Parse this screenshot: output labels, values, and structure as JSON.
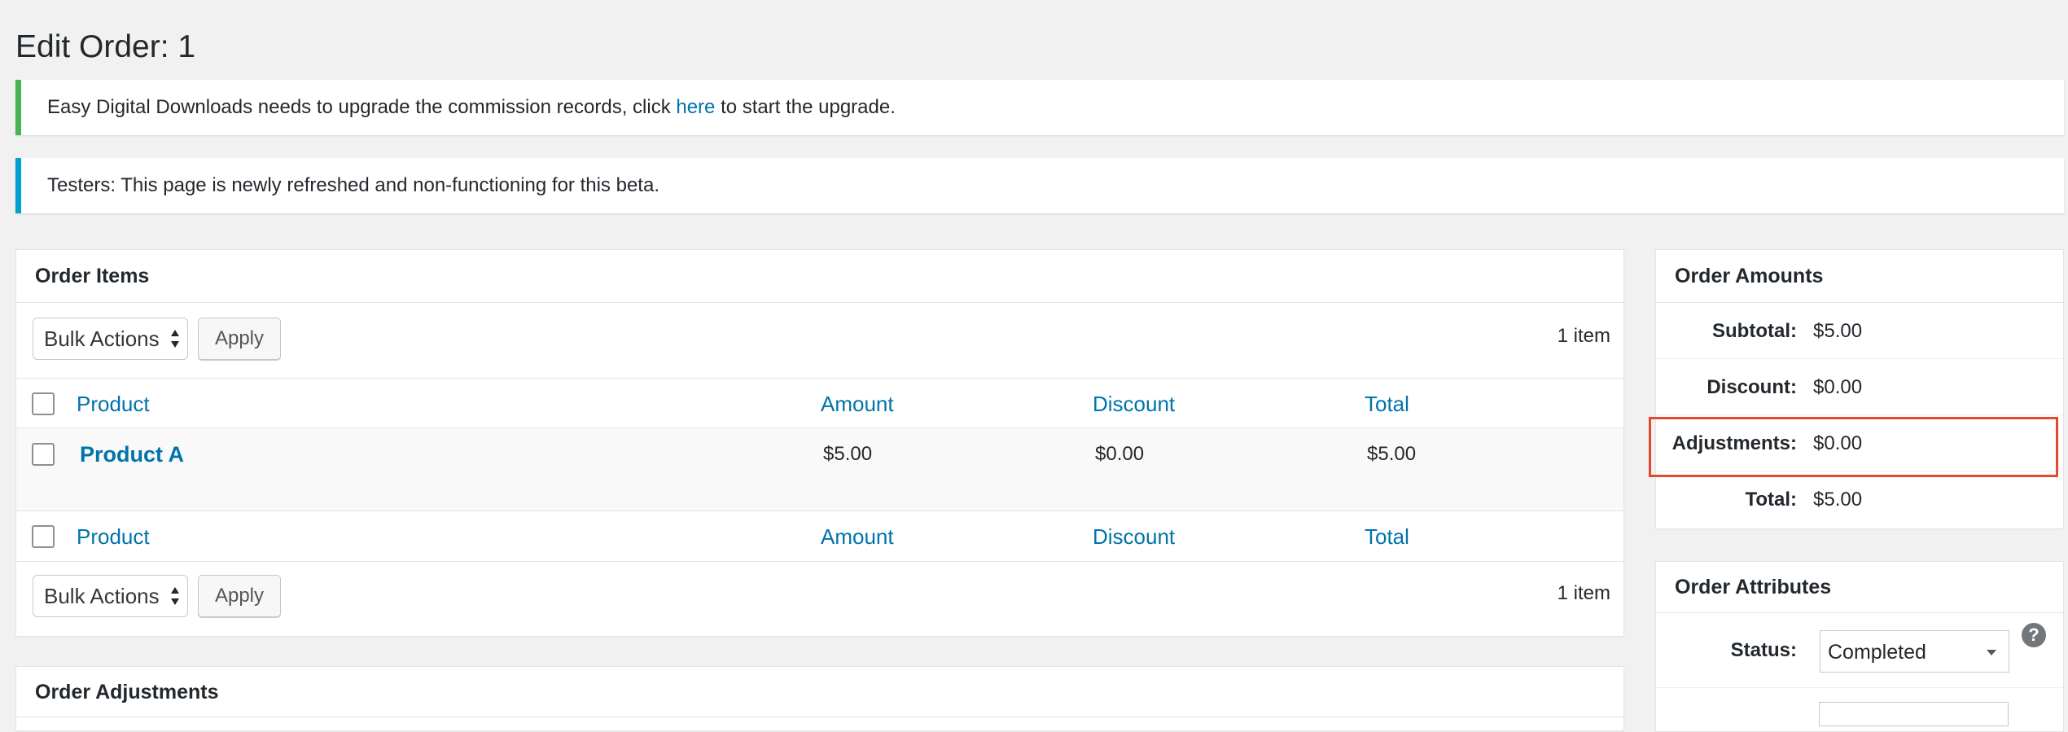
{
  "page": {
    "title": "Edit Order: 1"
  },
  "notices": {
    "upgrade": {
      "text_before": "Easy Digital Downloads needs to upgrade the commission records, click ",
      "link": "here",
      "text_after": " to start the upgrade."
    },
    "beta": {
      "text": "Testers: This page is newly refreshed and non-functioning for this beta."
    }
  },
  "order_items": {
    "title": "Order Items",
    "bulk_actions_label": "Bulk Actions",
    "apply_label": "Apply",
    "count": "1 item",
    "columns": [
      "Product",
      "Amount",
      "Discount",
      "Total"
    ],
    "rows": [
      {
        "product": "Product A",
        "amount": "$5.00",
        "discount": "$0.00",
        "total": "$5.00"
      }
    ]
  },
  "order_adjustments": {
    "title": "Order Adjustments"
  },
  "order_amounts": {
    "title": "Order Amounts",
    "rows": [
      {
        "label": "Subtotal:",
        "value": "$5.00"
      },
      {
        "label": "Discount:",
        "value": "$0.00"
      },
      {
        "label": "Adjustments:",
        "value": "$0.00"
      },
      {
        "label": "Total:",
        "value": "$5.00"
      }
    ],
    "highlight_color": "#e2492f"
  },
  "order_attributes": {
    "title": "Order Attributes",
    "status_label": "Status:",
    "status_value": "Completed",
    "help_icon": "?"
  },
  "colors": {
    "link": "#0073aa",
    "notice_success": "#46b450",
    "notice_info": "#00a0d2",
    "background": "#f1f1f1"
  }
}
